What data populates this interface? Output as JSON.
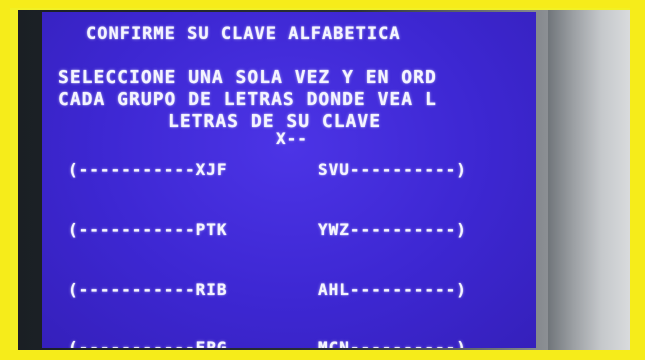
{
  "screen": {
    "title": "CONFIRME SU CLAVE ALFABETICA",
    "instruction_line1": "SELECCIONE UNA SOLA VEZ Y EN ORD",
    "instruction_line2": "CADA GRUPO DE LETRAS DONDE VEA L",
    "instruction_line3": "LETRAS DE SU CLAVE",
    "entered_marker": "X--"
  },
  "options": [
    {
      "left": "(-----------XJF",
      "right": "SVU----------)"
    },
    {
      "left": "(-----------PTK",
      "right": "YWZ----------)"
    },
    {
      "left": "(-----------RIB",
      "right": "AHL----------)"
    },
    {
      "left": "(-----------EPG",
      "right": "MCN----------)"
    }
  ],
  "colors": {
    "screen_bg": "#3d27d2",
    "text": "#f4f4ff",
    "border_highlight": "#f6ec1a"
  }
}
